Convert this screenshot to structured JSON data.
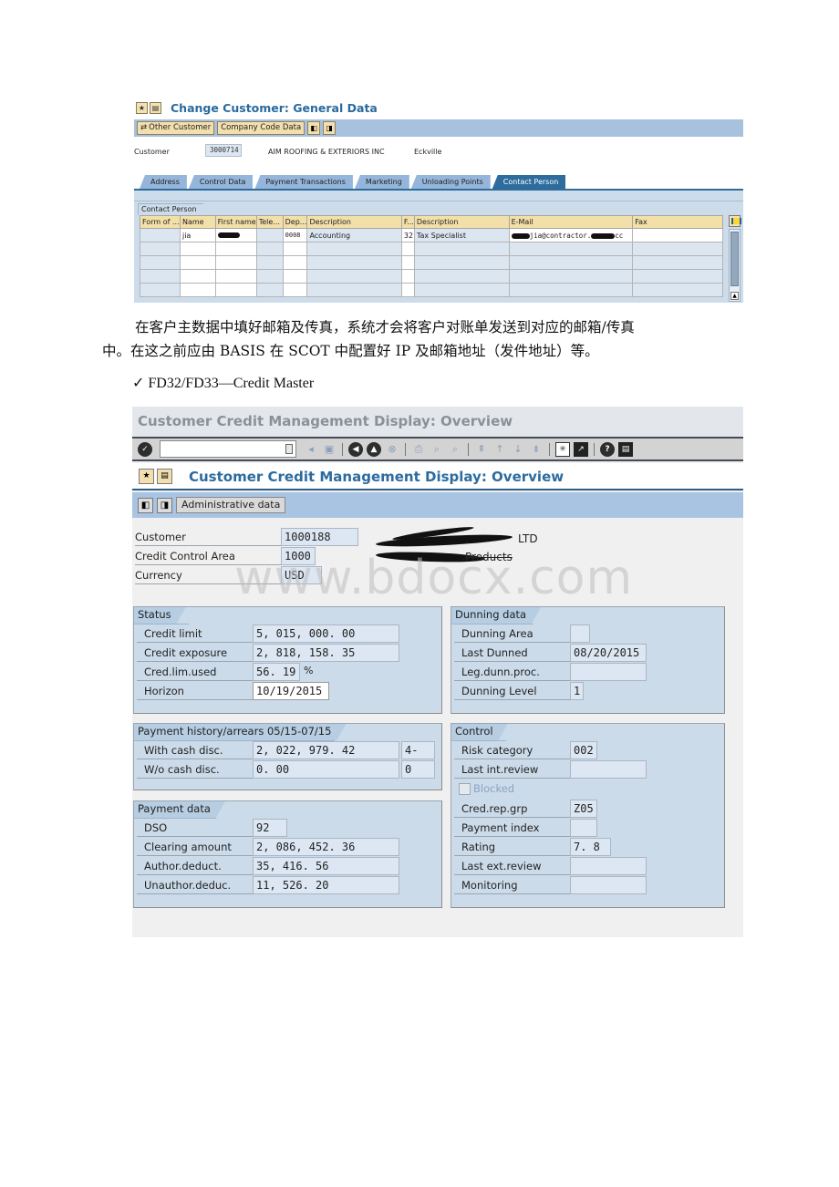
{
  "screenshot1": {
    "title": "Change Customer: General Data",
    "title_icons": [
      "favorites-icon",
      "menu-icon"
    ],
    "app_toolbar": {
      "other_customer": "Other Customer",
      "company_code_data": "Company Code Data",
      "icons": [
        "previous-icon",
        "next-icon"
      ]
    },
    "customer": {
      "label": "Customer",
      "number": "3000714",
      "name": "AIM ROOFING & EXTERIORS INC",
      "city": "Eckville"
    },
    "tabs": [
      {
        "label": "Address",
        "active": false
      },
      {
        "label": "Control Data",
        "active": false
      },
      {
        "label": "Payment Transactions",
        "active": false
      },
      {
        "label": "Marketing",
        "active": false
      },
      {
        "label": "Unloading Points",
        "active": false
      },
      {
        "label": "Contact Person",
        "active": true
      }
    ],
    "group_title": "Contact Person",
    "table": {
      "columns": [
        "Form of ...",
        "Name",
        "First name",
        "Tele...",
        "Dep...",
        "Description",
        "F...",
        "Description",
        "E-Mail",
        "Fax"
      ],
      "rows": [
        {
          "form": "",
          "name": "jia",
          "first_name": "[redacted]",
          "tele": "",
          "dep": "0008",
          "description": "Accounting",
          "f": "32",
          "description2": "Tax Specialist",
          "email": "jia@contractor.",
          "email_suffix": "cc",
          "fax": ""
        },
        {},
        {},
        {},
        {}
      ]
    }
  },
  "paragraph": {
    "line1": "在客户主数据中填好邮箱及传真，系统才会将客户对账单发送到对应的邮箱/传真",
    "line2": "中。在这之前应由 BASIS 在 SCOT 中配置好 IP 及邮箱地址（发件地址）等。"
  },
  "heading": "✓ FD32/FD33—Credit Master",
  "screenshot2": {
    "window_title": "Customer Credit Management Display: Overview",
    "command_field": "",
    "title": "Customer Credit Management Display: Overview",
    "admin_button": "Administrative data",
    "watermark": "www.bdocx.com",
    "header": {
      "customer_label": "Customer",
      "customer_value": "1000188",
      "customer_name_suffix": "LTD",
      "cca_label": "Credit Control Area",
      "cca_value": "1000",
      "cca_name_suffix": "Products",
      "currency_label": "Currency",
      "currency_value": "USD"
    },
    "status": {
      "title": "Status",
      "credit_limit_label": "Credit limit",
      "credit_limit": "5, 015, 000. 00",
      "credit_exposure_label": "Credit exposure",
      "credit_exposure": "2, 818, 158. 35",
      "cred_lim_used_label": "Cred.lim.used",
      "cred_lim_used": "56. 19",
      "percent": "%",
      "horizon_label": "Horizon",
      "horizon": "10/19/2015"
    },
    "dunning": {
      "title": "Dunning data",
      "area_label": "Dunning Area",
      "area": "",
      "last_dunned_label": "Last Dunned",
      "last_dunned": "08/20/2015",
      "leg_label": "Leg.dunn.proc.",
      "leg": "",
      "level_label": "Dunning Level",
      "level": "1"
    },
    "payment_history": {
      "title": "Payment history/arrears 05/15-07/15",
      "with_label": "With cash disc.",
      "with_value": "2, 022, 979. 42",
      "with_days": "4-",
      "without_label": "W/o cash disc.",
      "without_value": "0. 00",
      "without_days": "0"
    },
    "payment_data": {
      "title": "Payment data",
      "dso_label": "DSO",
      "dso": "92",
      "clearing_label": "Clearing amount",
      "clearing": "2, 086, 452. 36",
      "auth_label": "Author.deduct.",
      "auth": "35, 416. 56",
      "unauth_label": "Unauthor.deduc.",
      "unauth": "11, 526. 20"
    },
    "control": {
      "title": "Control",
      "risk_label": "Risk category",
      "risk": "002",
      "last_int_label": "Last int.review",
      "last_int": "",
      "blocked_label": "Blocked",
      "blocked": false,
      "cred_rep_label": "Cred.rep.grp",
      "cred_rep": "Z05",
      "pay_index_label": "Payment index",
      "pay_index": "",
      "rating_label": "Rating",
      "rating": "7. 8",
      "last_ext_label": "Last ext.review",
      "last_ext": "",
      "monitoring_label": "Monitoring",
      "monitoring": ""
    }
  }
}
